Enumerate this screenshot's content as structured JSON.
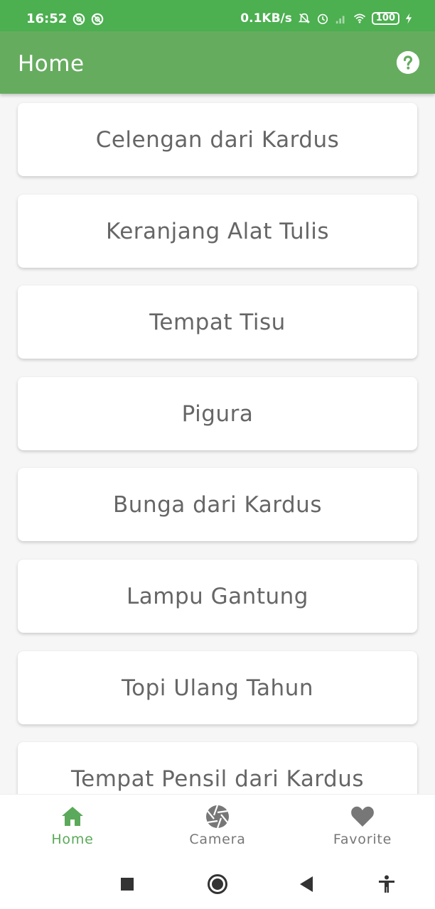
{
  "status_bar": {
    "time": "16:52",
    "network_speed": "0.1KB/s",
    "battery": "100",
    "left_icons": [
      "app-notification-icon",
      "app-notification-icon"
    ],
    "right_icons": [
      "mute-bell-icon",
      "alarm-icon",
      "signal-icon",
      "wifi-icon",
      "battery-icon",
      "charging-icon"
    ]
  },
  "app_bar": {
    "title": "Home",
    "help_icon": "help-circle-icon"
  },
  "items": [
    {
      "label": "Celengan dari Kardus"
    },
    {
      "label": "Keranjang Alat Tulis"
    },
    {
      "label": "Tempat Tisu"
    },
    {
      "label": "Pigura"
    },
    {
      "label": "Bunga dari Kardus"
    },
    {
      "label": "Lampu Gantung"
    },
    {
      "label": "Topi Ulang Tahun"
    },
    {
      "label": "Tempat Pensil dari Kardus"
    }
  ],
  "bottom_nav": {
    "items": [
      {
        "label": "Home",
        "icon": "home-icon",
        "active": true
      },
      {
        "label": "Camera",
        "icon": "camera-shutter-icon",
        "active": false
      },
      {
        "label": "Favorite",
        "icon": "heart-icon",
        "active": false
      }
    ]
  },
  "system_nav": {
    "buttons": [
      "recents-square-icon",
      "home-circle-icon",
      "back-triangle-icon",
      "accessibility-icon"
    ]
  },
  "colors": {
    "status_bar": "#4caf50",
    "app_bar": "#66ac5f",
    "accent": "#5ba95a",
    "card_text": "#666666",
    "inactive": "#777777"
  }
}
